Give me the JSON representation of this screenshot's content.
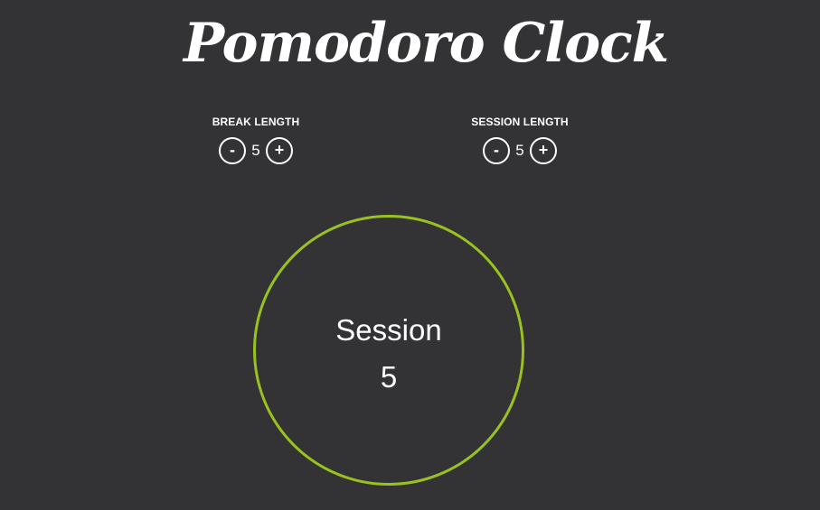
{
  "app": {
    "title": "Pomodoro Clock"
  },
  "break_control": {
    "label": "BREAK LENGTH",
    "decrement": "-",
    "value": "5",
    "increment": "+"
  },
  "session_control": {
    "label": "SESSION LENGTH",
    "decrement": "-",
    "value": "5",
    "increment": "+"
  },
  "clock": {
    "mode": "Session",
    "time": "5"
  },
  "colors": {
    "background": "#333335",
    "text": "#ffffff",
    "ring": "#99c21f"
  }
}
